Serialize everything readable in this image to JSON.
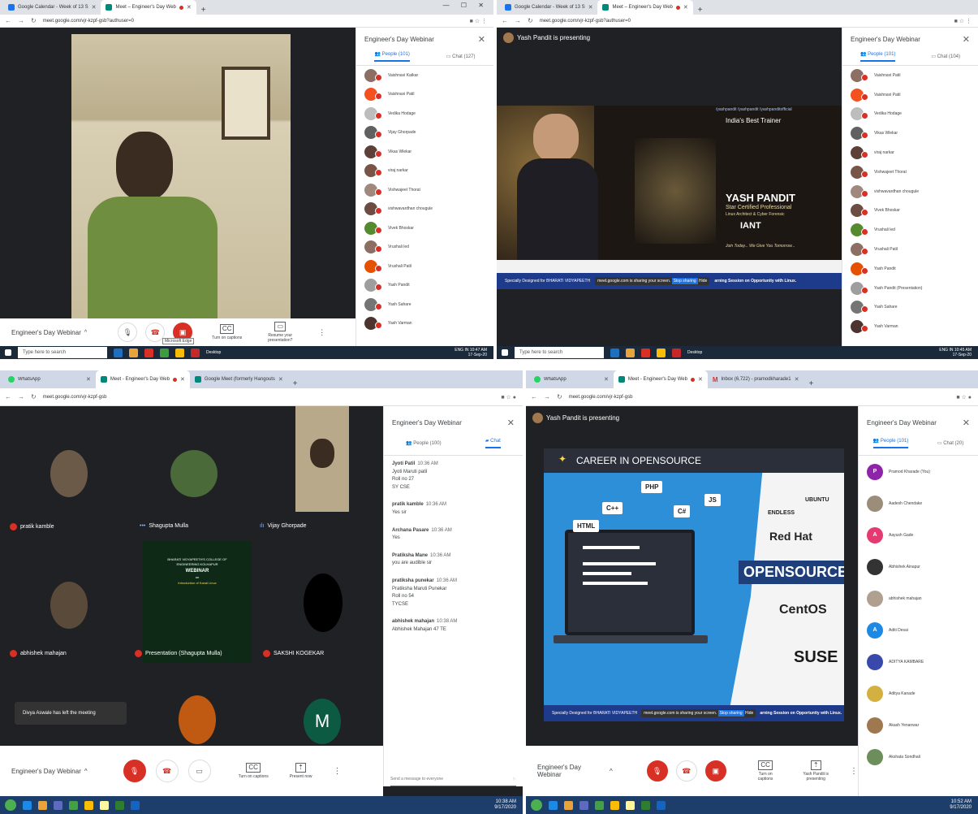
{
  "q1": {
    "tabs": [
      "Google Calendar - Week of 13 S",
      "Meet – Engineer's Day Web"
    ],
    "url": "meet.google.com/vjr-kzpf-gsb?authuser=0",
    "panel_title": "Engineer's Day Webinar",
    "people_tab": "People (101)",
    "chat_tab": "Chat (127)",
    "participants": [
      "Vaishnavi Katkar",
      "Vaishnavi Patil",
      "Vedika Hodage",
      "Vijay Ghorpade",
      "Vikas Wlekar",
      "viraj narkar",
      "Vishwajeet Thorat",
      "vishwavardhan chougule",
      "Vivek Bhoskar",
      "Vrushali led",
      "Vrushali Patil",
      "Yash Pandit",
      "Yash Sahare",
      "Yash Varman"
    ],
    "meeting_title": "Engineer's Day Webinar",
    "captions": "Turn on captions",
    "resume": "Resume your presentation?",
    "tooltip": "Microsoft Edge",
    "search": "Type here to search",
    "desktop": "Desktop",
    "lang": "ENG IN",
    "time": "10:47 AM",
    "date": "17-Sep-20"
  },
  "q2": {
    "tabs": [
      "Google Calendar - Week of 13 S",
      "Meet – Engineer's Day Web"
    ],
    "url": "meet.google.com/vjr-kzpf-gsb?authuser=0",
    "presenting": "Yash Pandit is presenting",
    "panel_title": "Engineer's Day Webinar",
    "people_tab": "People (101)",
    "chat_tab": "Chat (104)",
    "participants": [
      "Vaishnavi Patil",
      "Vaishnavi Patil",
      "Vedika Hodage",
      "Vikas Wlekar",
      "viraj narkar",
      "Vishwajeet Thorat",
      "vishwavardhan chougule",
      "Vivek Bhoskar",
      "Vrushali led",
      "Vrushali Patil",
      "Yash Pandit",
      "Yash Pandit (Presentation)",
      "Yash Sahare",
      "Yash Varman"
    ],
    "slide": {
      "social": "/yashpandit  /yashpandit  /yashpanditofficial",
      "tagline": "India's Best Trainer",
      "name": "YASH PANDIT",
      "role1": "Star Certified Professional",
      "role2": "Linux Architect & Cyber Forensic",
      "brand": "IANT",
      "join": "Join Today... We Give You Tomorrow...",
      "banner": "Specially Designed for BHARATI VIDYAPEETH",
      "banner2": "arning Session on Opportunity with Linux.",
      "share": "meet.google.com is sharing your screen.",
      "stop": "Stop sharing",
      "hide": "Hide"
    },
    "search": "Type here to search",
    "desktop": "Desktop",
    "lang": "ENG IN",
    "time": "10:45 AM",
    "date": "17-Sep-20"
  },
  "q3": {
    "tabs": [
      "WhatsApp",
      "Meet - Engineer's Day Web",
      "Google Meet (formerly Hangouts"
    ],
    "url": "meet.google.com/vjr-kzpf-gsb",
    "tiles": [
      "pratik kamble",
      "Shagupta Mulla",
      "Vijay Ghorpade",
      "abhishek mahajan",
      "Presentation (Shagupta Mulla)",
      "SAKSHI KOGEKAR"
    ],
    "tile_letter": "M",
    "toast": "Divya Aswale has left the meeting",
    "panel_title": "Engineer's Day Webinar",
    "people_tab": "People (100)",
    "chat_tab": "Chat",
    "messages": [
      {
        "who": "Jyoti Patil",
        "time": "10:36 AM",
        "lines": [
          "Jyoti Maruti patil",
          "Roll no 27",
          "SY CSE"
        ]
      },
      {
        "who": "pratik kamble",
        "time": "10:36 AM",
        "lines": [
          "Yes sir"
        ]
      },
      {
        "who": "Archana Pasare",
        "time": "10:36 AM",
        "lines": [
          "Yes"
        ]
      },
      {
        "who": "Pratiksha Mane",
        "time": "10:36 AM",
        "lines": [
          "you are audible sir"
        ]
      },
      {
        "who": "pratiksha punekar",
        "time": "10:36 AM",
        "lines": [
          "Pratiksha Maruti Punekar",
          "Roll no 54",
          "TYCSE"
        ]
      },
      {
        "who": "abhishek mahajan",
        "time": "10:38 AM",
        "lines": [
          "Abhishek Mahajan 47 TE"
        ]
      }
    ],
    "send_placeholder": "Send a message to everyone",
    "meeting_title": "Engineer's Day Webinar",
    "captions": "Turn on captions",
    "present": "Present now",
    "poster": [
      "BHARATI VIDYAPEETH'S COLLEGE OF",
      "ENGINEERING KOLHAPUR",
      "WEBINAR",
      "on",
      "Introduction of Kanal Linux"
    ],
    "time": "10:38 AM",
    "date": "9/17/2020"
  },
  "q4": {
    "tabs": [
      "WhatsApp",
      "Meet - Engineer's Day Web",
      "Inbox (6,722) - pramodkharade1"
    ],
    "url": "meet.google.com/vjr-kzpf-gsb",
    "presenting": "Yash Pandit is presenting",
    "panel_title": "Engineer's Day Webinar",
    "people_tab": "People (101)",
    "chat_tab": "Chat (20)",
    "participants": [
      {
        "letter": "P",
        "name": "Pramod Kharade (You)",
        "color": "#8e24aa"
      },
      {
        "letter": "",
        "name": "Aadesh Chendake",
        "color": "#9c8c7a"
      },
      {
        "letter": "A",
        "name": "Aayush Gade",
        "color": "#e53972"
      },
      {
        "letter": "",
        "name": "Abhishek Ainapur",
        "color": "#333333"
      },
      {
        "letter": "",
        "name": "abhishek mahajan",
        "color": "#b0a090"
      },
      {
        "letter": "A",
        "name": "Aditi Desai",
        "color": "#1e88e5"
      },
      {
        "letter": "",
        "name": "ADITYA KAMBARE",
        "color": "#3949ab"
      },
      {
        "letter": "",
        "name": "Aditya Kanade",
        "color": "#d4b040"
      },
      {
        "letter": "",
        "name": "Akash Yenanwar",
        "color": "#a07850"
      },
      {
        "letter": "",
        "name": "Akshata Sondhali",
        "color": "#6b8e5a"
      }
    ],
    "slide": {
      "title": "CAREER IN OPENSOURCE",
      "langs": [
        "PHP",
        "C++",
        "C#",
        "JS",
        "HTML"
      ],
      "endless": "ENDLESS",
      "ubuntu": "UBUNTU",
      "redhat": "Red Hat",
      "opensource": "OPENSOURCE",
      "centos": "CentOS",
      "suse": "SUSE",
      "banner": "Specially Designed for BHARATI VIDYAPEETH",
      "banner2": "arning Session on Opportunity with Linux.",
      "share": "meet.google.com is sharing your screen.",
      "stop": "Stop sharing",
      "hide": "Hide"
    },
    "meeting_title": "Engineer's Day Webinar",
    "captions": "Turn on captions",
    "presenting_btn": "Yash Pandit is presenting",
    "time": "10:52 AM",
    "date": "9/17/2020"
  }
}
